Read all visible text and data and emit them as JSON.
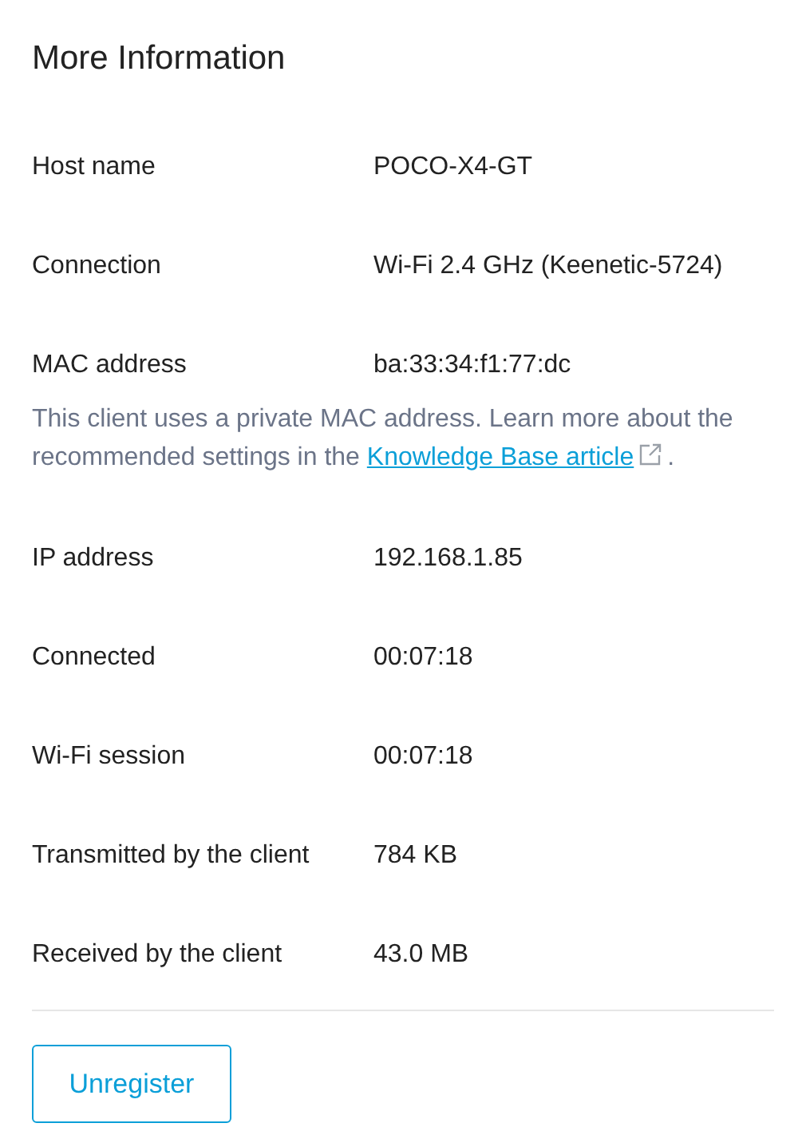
{
  "title": "More Information",
  "rows": [
    {
      "label": "Host name",
      "value": "POCO-X4-GT"
    },
    {
      "label": "Connection",
      "value": "Wi-Fi 2.4 GHz (Keenetic-5724)"
    },
    {
      "label": "MAC address",
      "value": "ba:33:34:f1:77:dc",
      "note": {
        "text": "This client uses a private MAC address. Learn more about the recommended settings in the",
        "link": "Knowledge Base article",
        "after": "."
      }
    },
    {
      "label": "IP address",
      "value": "192.168.1.85"
    },
    {
      "label": "Connected",
      "value": "00:07:18"
    },
    {
      "label": "Wi-Fi session",
      "value": "00:07:18"
    },
    {
      "label": "Transmitted by the client",
      "value": "784 KB"
    },
    {
      "label": "Received by the client",
      "value": "43.0 MB"
    }
  ],
  "button": "Unregister"
}
